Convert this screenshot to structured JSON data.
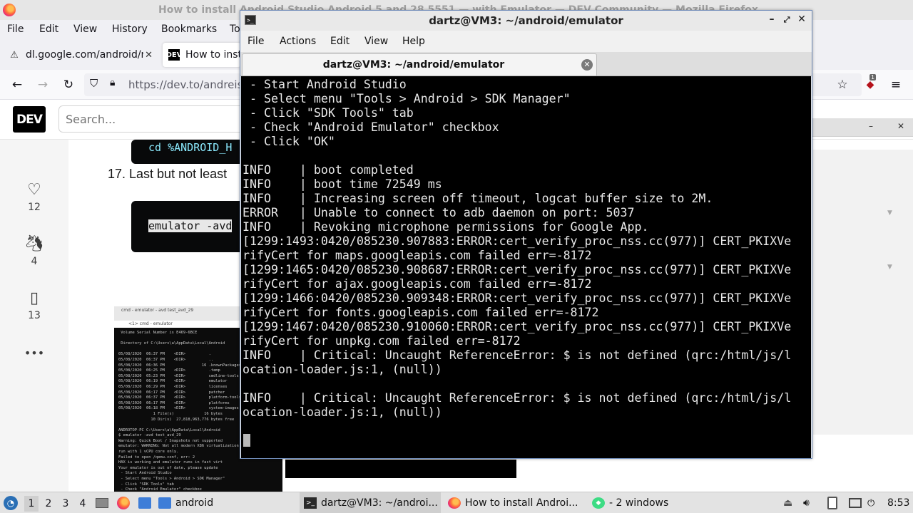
{
  "firefox": {
    "title": "How to install Android Studio Android 5 and 28 5551 — with Emulator — DEV Community — Mozilla Firefox",
    "menu": [
      "File",
      "Edit",
      "View",
      "History",
      "Bookmarks",
      "To"
    ],
    "tabs": [
      {
        "label": "dl.google.com/android/re",
        "favicon": "warning-icon"
      },
      {
        "label": "How to insta",
        "favicon": "dev-favicon"
      }
    ],
    "url": "https://dev.to/andreisf",
    "extension_badge": "1"
  },
  "devto": {
    "logo": "DEV",
    "search_placeholder": "Search...",
    "reactions": [
      {
        "icon": "heart-icon",
        "count": "12"
      },
      {
        "icon": "unicorn-icon",
        "count": "4"
      },
      {
        "icon": "bookmark-icon",
        "count": "13"
      }
    ],
    "more": "•••",
    "code_top": "cd %ANDROID_H",
    "step17": "17. Last but not least",
    "code_cmd": "emulator -avd",
    "cmd_window_title": "cmd - emulator - avd test_avd_29",
    "cmd_tab": "<1> cmd - emulator",
    "cmd_text": " Volume Serial Number is E469-6BCE\n\n Directory of C:\\Users\\a\\AppData\\Local\\Android\n\n05/08/2020  06:37 PM    <DIR>          .\n05/08/2020  06:37 PM    <DIR>          ..\n05/08/2020  06:36 PM                16 .knownPackages\n05/08/2020  06:25 PM    <DIR>          .temp\n05/08/2020  05:23 PM    <DIR>          cmdline-tools\n05/08/2020  06:19 PM    <DIR>          emulator\n05/08/2020  06:29 PM    <DIR>          licenses\n05/08/2020  06:17 PM    <DIR>          patcher\n05/08/2020  06:37 PM    <DIR>          platform-tools\n05/08/2020  06:17 PM    <DIR>          platforms\n05/08/2020  06:18 PM    <DIR>          system-images\n               1 File(s)             16 bytes\n              10 Dir(s)  27,818,963,776 bytes free\n\nANDROTOP-PC C:\\Users\\a\\AppData\\Local\\Android\n$ emulator -avd test_avd_29\nWarning: Quick Boot / Snapshots not supported\nemulator: WARNING: Not all modern X86 virtualization\nrun with 1 vCPU core only.\nFailed to open /qemu.conf, err: 2\nHAX is working and emulator runs in fast virt\nYour emulator is out of date, please update\n - Start Android Studio\n - Select menu \"Tools > Android > SDK Manager\"\n - Click \"SDK Tools\" tab\n - Check \"Android Emulator\" checkbox\n - Click \"OK\""
  },
  "terminal": {
    "title": "dartz@VM3: ~/android/emulator",
    "menu": [
      "File",
      "Actions",
      "Edit",
      "View",
      "Help"
    ],
    "tab_label": "dartz@VM3: ~/android/emulator",
    "lines": [
      " - Start Android Studio",
      " - Select menu \"Tools > Android > SDK Manager\"",
      " - Click \"SDK Tools\" tab",
      " - Check \"Android Emulator\" checkbox",
      " - Click \"OK\"",
      "",
      "INFO    | boot completed",
      "INFO    | boot time 72549 ms",
      "INFO    | Increasing screen off timeout, logcat buffer size to 2M.",
      "ERROR   | Unable to connect to adb daemon on port: 5037",
      "INFO    | Revoking microphone permissions for Google App.",
      "[1299:1493:0420/085230.907883:ERROR:cert_verify_proc_nss.cc(977)] CERT_PKIXVe",
      "rifyCert for maps.googleapis.com failed err=-8172",
      "[1299:1465:0420/085230.908687:ERROR:cert_verify_proc_nss.cc(977)] CERT_PKIXVe",
      "rifyCert for ajax.googleapis.com failed err=-8172",
      "[1299:1466:0420/085230.909348:ERROR:cert_verify_proc_nss.cc(977)] CERT_PKIXVe",
      "rifyCert for fonts.googleapis.com failed err=-8172",
      "[1299:1467:0420/085230.910060:ERROR:cert_verify_proc_nss.cc(977)] CERT_PKIXVe",
      "rifyCert for unpkg.com failed err=-8172",
      "INFO    | Critical: Uncaught ReferenceError: $ is not defined (qrc:/html/js/l",
      "ocation-loader.js:1, (null))",
      "",
      "INFO    | Critical: Uncaught ReferenceError: $ is not defined (qrc:/html/js/l",
      "ocation-loader.js:1, (null))"
    ]
  },
  "taskbar": {
    "workspaces": [
      "1",
      "2",
      "3",
      "4"
    ],
    "folder_label": "android",
    "tasks": [
      {
        "label": "dartz@VM3: ~/androi...",
        "icon": "terminal-icon"
      },
      {
        "label": "How to install Androi...",
        "icon": "firefox-icon"
      },
      {
        "label": "- 2 windows",
        "icon": "android-studio-icon"
      }
    ],
    "clock": "8:53"
  },
  "colors": {
    "terminal_bg": "#000000",
    "terminal_fg": "#e8e8e8",
    "dev_black": "#000000",
    "taskbar": "#e3e3e3"
  }
}
